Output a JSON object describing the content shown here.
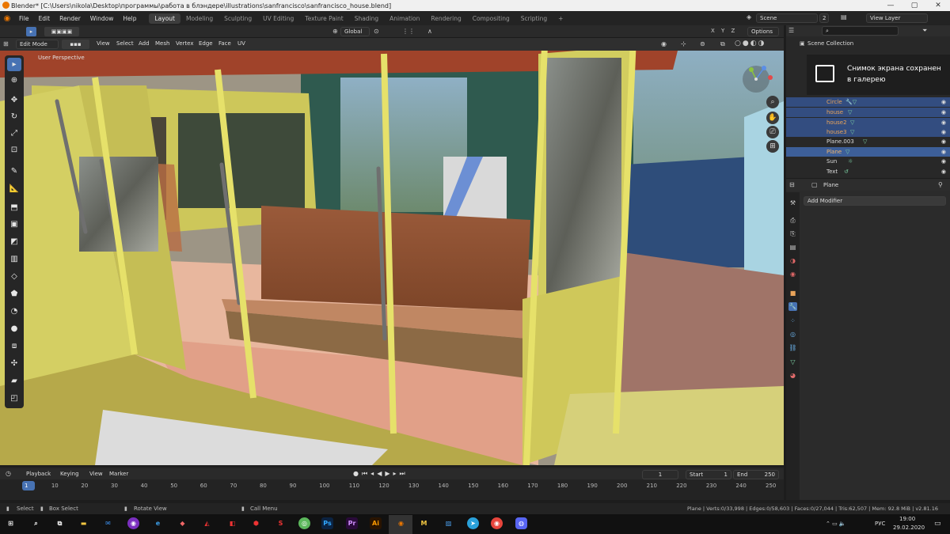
{
  "window": {
    "title": "Blender* [C:\\Users\\nikola\\Desktop\\программы\\работа в блэндере\\illustrations\\sanfrancisco\\sanfrancisco_house.blend]",
    "controls": [
      "—",
      "▢",
      "✕"
    ]
  },
  "menu": [
    "File",
    "Edit",
    "Render",
    "Window",
    "Help"
  ],
  "workspaces": [
    "Layout",
    "Modeling",
    "Sculpting",
    "UV Editing",
    "Texture Paint",
    "Shading",
    "Animation",
    "Rendering",
    "Compositing",
    "Scripting",
    "+"
  ],
  "scene": {
    "name": "Scene",
    "count": "2",
    "view_layer": "View Layer"
  },
  "header": {
    "orientation": "Global",
    "axes": "X Y Z",
    "options": "Options"
  },
  "viewport_header": {
    "mode": "Edit Mode",
    "menus": [
      "View",
      "Select",
      "Add",
      "Mesh",
      "Vertex",
      "Edge",
      "Face",
      "UV"
    ]
  },
  "viewport": {
    "label": "User Perspective"
  },
  "outliner": {
    "title": "Scene Collection",
    "items": [
      {
        "name": "Circle",
        "selected": true
      },
      {
        "name": "house",
        "selected": true
      },
      {
        "name": "house2",
        "selected": true
      },
      {
        "name": "house3",
        "selected": true
      },
      {
        "name": "Plane.003",
        "selected": false
      },
      {
        "name": "Plane",
        "selected": true,
        "active": true
      },
      {
        "name": "Sun",
        "selected": false
      },
      {
        "name": "Text",
        "selected": false
      }
    ]
  },
  "toast": {
    "line1": "Снимок экрана сохранен",
    "line2": "в галерею"
  },
  "properties": {
    "object": "Plane",
    "add_modifier": "Add Modifier"
  },
  "timeline": {
    "menus": [
      "Playback",
      "Keying",
      "View",
      "Marker"
    ],
    "current_frame": "1",
    "start_label": "Start",
    "start": "1",
    "end_label": "End",
    "end": "250",
    "ticks": [
      "1",
      "10",
      "20",
      "30",
      "40",
      "50",
      "60",
      "70",
      "80",
      "90",
      "100",
      "110",
      "120",
      "130",
      "140",
      "150",
      "160",
      "170",
      "180",
      "190",
      "200",
      "210",
      "220",
      "230",
      "240",
      "250"
    ]
  },
  "status": {
    "select": "Select",
    "box_select": "Box Select",
    "rotate": "Rotate View",
    "call_menu": "Call Menu",
    "stats": "Plane | Verts:0/33,998 | Edges:0/58,603 | Faces:0/27,044 | Tris:62,507 | Mem: 92.8 MiB | v2.81.16"
  },
  "taskbar": {
    "lang": "РУС",
    "time": "19:00",
    "date": "29.02.2020"
  },
  "colors": {
    "accent": "#4772b3",
    "selected_row": "#334d80",
    "blender_orange": "#ea7600",
    "object_orange": "#e8a35a"
  }
}
